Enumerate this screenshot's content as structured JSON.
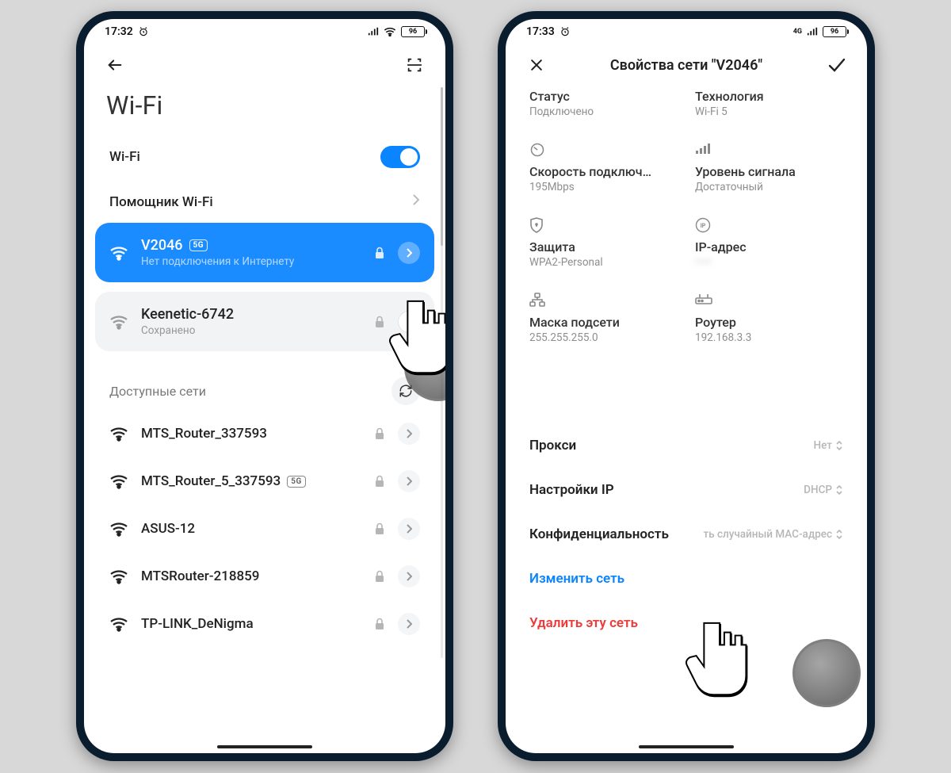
{
  "phone1": {
    "status": {
      "time": "17:32",
      "battery": "96"
    },
    "page_title": "Wi-Fi",
    "wifi_toggle_label": "Wi-Fi",
    "assistant_label": "Помощник Wi-Fi",
    "connected": {
      "name": "V2046",
      "badge": "5G",
      "sub": "Нет подключения к Интернету"
    },
    "saved": {
      "name": "Keenetic-6742",
      "sub": "Сохранено"
    },
    "available_header": "Доступные сети",
    "available": [
      {
        "name": "MTS_Router_337593",
        "badge": ""
      },
      {
        "name": "MTS_Router_5_337593",
        "badge": "5G"
      },
      {
        "name": "ASUS-12",
        "badge": ""
      },
      {
        "name": "MTSRouter-218859",
        "badge": ""
      },
      {
        "name": "TP-LINK_DeNigma",
        "badge": ""
      }
    ]
  },
  "phone2": {
    "status": {
      "time": "17:33",
      "battery": "96"
    },
    "title": "Свойства сети \"V2046\"",
    "details": {
      "status_label": "Статус",
      "status_val": "Подключено",
      "tech_label": "Технология",
      "tech_val": "Wi-Fi 5",
      "speed_label": "Скорость подключ…",
      "speed_val": "195Mbps",
      "signal_label": "Уровень сигнала",
      "signal_val": "Достаточный",
      "security_label": "Защита",
      "security_val": "WPA2-Personal",
      "ip_label": "IP-адрес",
      "ip_val": "——",
      "mask_label": "Маска подсети",
      "mask_val": "255.255.255.0",
      "router_label": "Роутер",
      "router_val": "192.168.3.3"
    },
    "settings": {
      "proxy_label": "Прокси",
      "proxy_val": "Нет",
      "ip_label": "Настройки IP",
      "ip_val": "DHCP",
      "priv_label": "Конфиденциальность",
      "priv_val": "ть случайный MAC-адрес"
    },
    "actions": {
      "edit": "Изменить сеть",
      "delete": "Удалить эту сеть"
    }
  }
}
